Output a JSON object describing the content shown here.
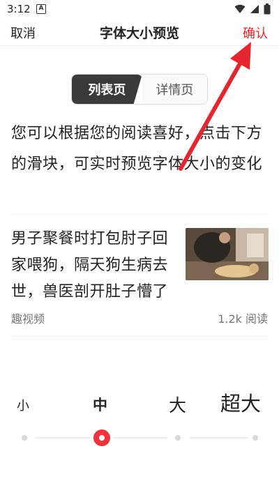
{
  "status_bar": {
    "time": "3:12",
    "badge": "A",
    "icons": [
      "wifi-icon",
      "signal-icon",
      "battery-icon"
    ]
  },
  "nav": {
    "cancel_label": "取消",
    "title": "字体大小预览",
    "confirm_label": "确认"
  },
  "segment": {
    "tabs": [
      {
        "label": "列表页",
        "active": true
      },
      {
        "label": "详情页",
        "active": false
      }
    ]
  },
  "description": "您可以根据您的阅读喜好，点击下方的滑块，可实时预览字体大小的变化",
  "article": {
    "title": "男子聚餐时打包肘子回家喂狗，隔天狗生病去世，兽医剖开肚子懵了",
    "source": "趣视频",
    "reads": "1.2k 阅读"
  },
  "font_size": {
    "options": [
      "小",
      "中",
      "大",
      "超大"
    ],
    "selected_index": 1
  },
  "colors": {
    "accent": "#e8262c",
    "segment_active": "#3a3a3a",
    "arrow": "#e6262e"
  }
}
